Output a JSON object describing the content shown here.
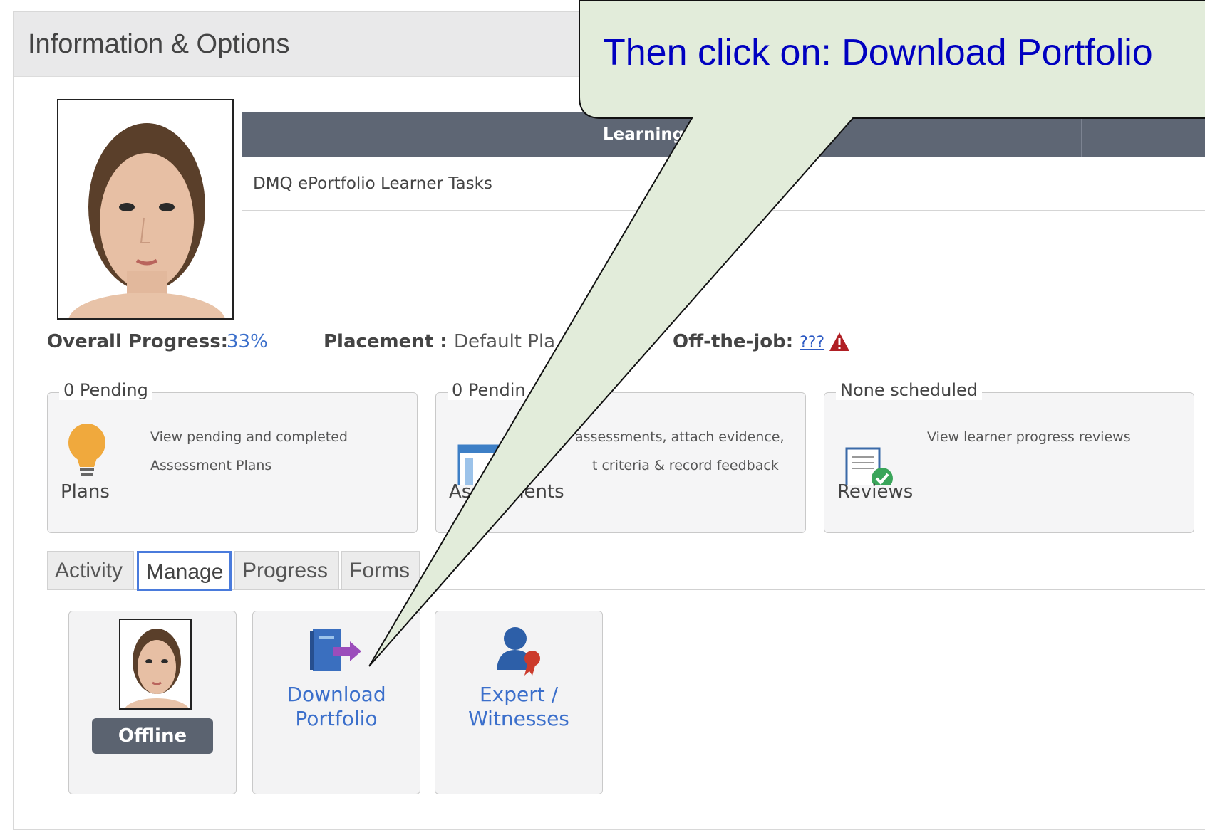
{
  "panel": {
    "title": "Information & Options"
  },
  "learning_table": {
    "header": "Learning",
    "rows": [
      "DMQ ePortfolio Learner Tasks"
    ]
  },
  "info": {
    "overall_progress_label": "Overall Progress:",
    "overall_progress_value": "33%",
    "placement_label": "Placement :",
    "placement_value": "Default Pla",
    "offjob_label": "Off-the-job:",
    "offjob_value": "???"
  },
  "boxes": [
    {
      "legend": "0 Pending",
      "text_line1": "View pending and completed",
      "text_line2": "Assessment Plans",
      "title": "Plans",
      "icon": "lightbulb-icon"
    },
    {
      "legend": "0 Pendin",
      "text_line1": "assessments, attach evidence,",
      "text_line2": "t criteria & record feedback",
      "title_left": "As",
      "title_right": "nents",
      "icon": "assessment-window-icon"
    },
    {
      "legend": "None scheduled",
      "text_line1": "View learner progress reviews",
      "title": "Reviews",
      "icon": "review-checklist-icon"
    }
  ],
  "tabs": [
    "Activity",
    "Manage",
    "Progress",
    "Forms"
  ],
  "active_tab": "Manage",
  "tiles": {
    "offline": "Offline",
    "download_line1": "Download",
    "download_line2": "Portfolio",
    "expert_line1": "Expert /",
    "expert_line2": "Witnesses"
  },
  "callout": {
    "text": "Then click on: Download Portfolio"
  },
  "colors": {
    "header_bg": "#5e6674",
    "link": "#3b6fcb",
    "callout_bg": "#e2ecda",
    "callout_text": "#0000c0",
    "warn": "#b01f24"
  }
}
